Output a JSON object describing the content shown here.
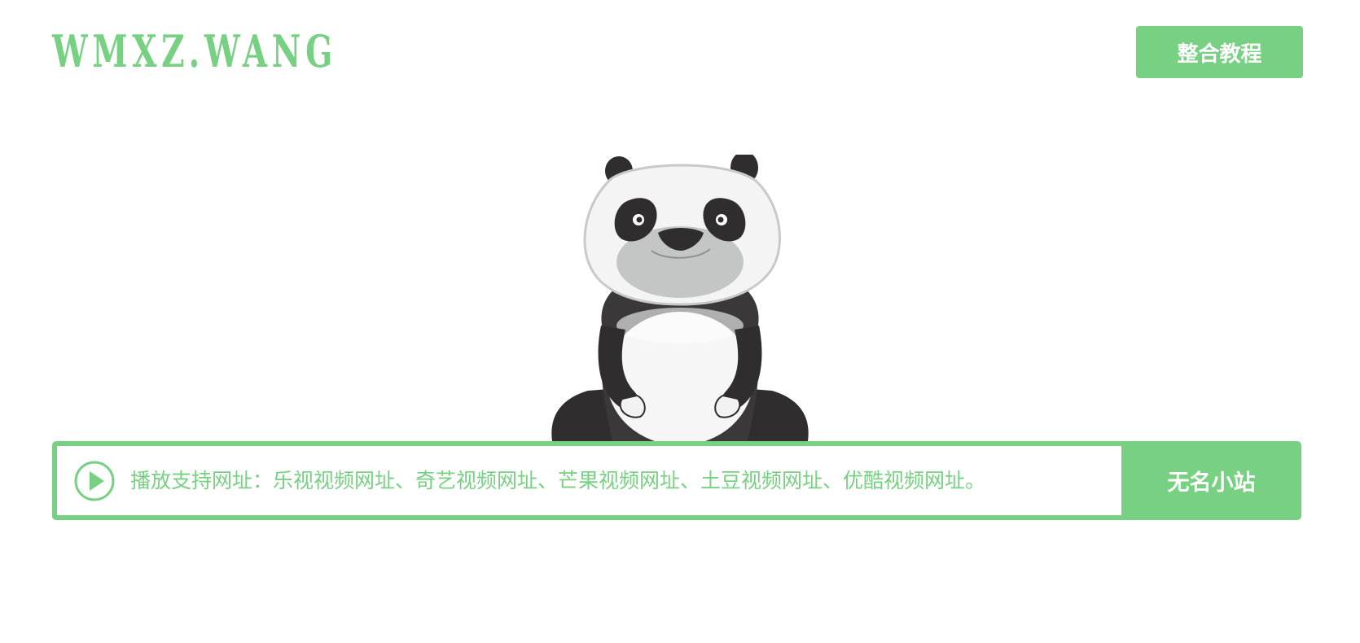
{
  "colors": {
    "accent": "#78d083",
    "background": "#ffffff",
    "button_text": "#ffffff"
  },
  "header": {
    "logo_text": "WMXZ.WANG",
    "tutorial_button_label": "整合教程"
  },
  "hero": {
    "illustration": "panda-illustration"
  },
  "player_bar": {
    "icon": "play-circle-icon",
    "input_placeholder": "播放支持网址：乐视视频网址、奇艺视频网址、芒果视频网址、土豆视频网址、优酷视频网址。",
    "input_value": "",
    "submit_button_label": "无名小站"
  }
}
